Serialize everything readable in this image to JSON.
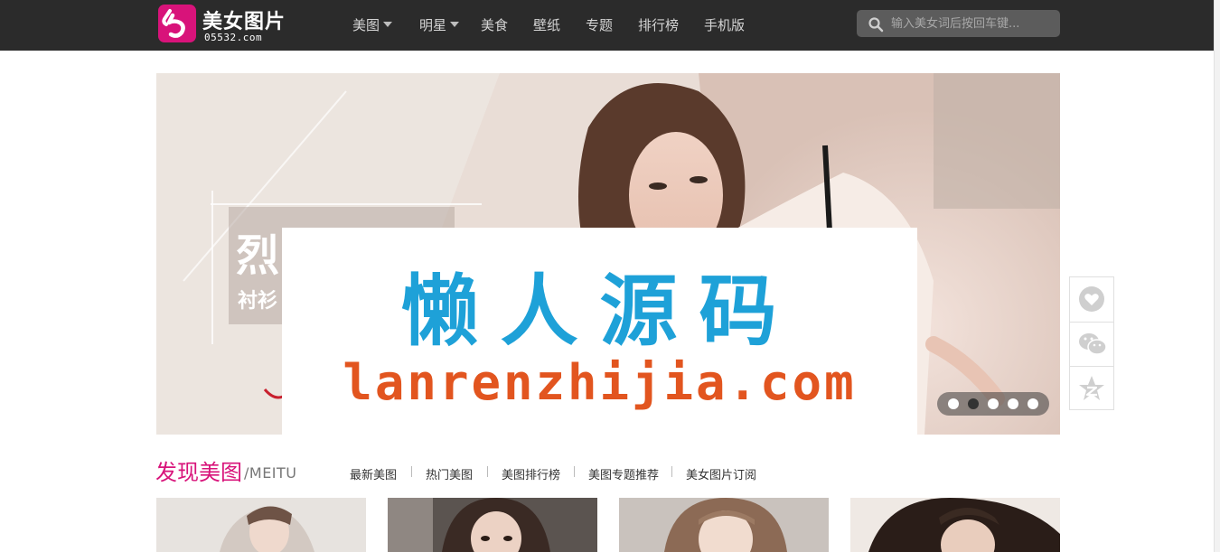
{
  "header": {
    "logo": {
      "title": "美女图片",
      "domain": "05532.com"
    },
    "nav": [
      {
        "label": "美图",
        "has_dropdown": true
      },
      {
        "label": "明星",
        "has_dropdown": true
      },
      {
        "label": "美食",
        "has_dropdown": false
      },
      {
        "label": "壁纸",
        "has_dropdown": false
      },
      {
        "label": "专题",
        "has_dropdown": false
      },
      {
        "label": "排行榜",
        "has_dropdown": false
      },
      {
        "label": "手机版",
        "has_dropdown": false
      }
    ],
    "search": {
      "placeholder": "输入美女词后按回车键..."
    }
  },
  "banner": {
    "text_big": "烈",
    "text_small": "衬衫",
    "slides": 5,
    "active_slide": 2
  },
  "watermark": {
    "cn": "懒人源码",
    "en": "lanrenzhijia.com"
  },
  "side_toolbar": {
    "icons": [
      "heart-icon",
      "wechat-icon",
      "qzone-star-icon"
    ]
  },
  "section": {
    "title": "发现美图",
    "subtitle": "/MEITU",
    "tabs": [
      "最新美图",
      "热门美图",
      "美图排行榜",
      "美图专题推荐",
      "美女图片订阅"
    ]
  },
  "colors": {
    "topbar": "#2b2b2b",
    "brand_pink": "#d8137a",
    "watermark_blue": "#1ea1d8",
    "watermark_orange": "#e2551f"
  }
}
